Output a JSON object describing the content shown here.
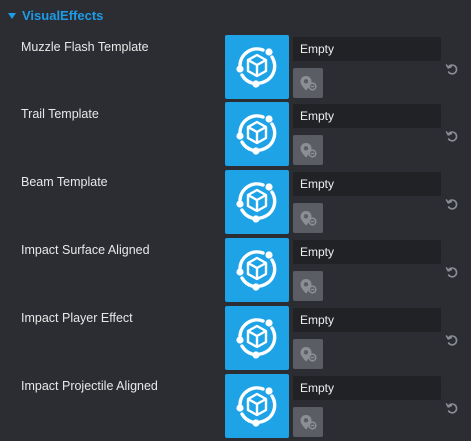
{
  "section": {
    "title": "VisualEffects",
    "expanded": true,
    "accent_color": "#1e9be6"
  },
  "asset_icon": "cube-orbit-icon",
  "picker_icon": "location-pin-icon",
  "reset_icon": "reset-icon",
  "thumbnail_color": "#1ea3e6",
  "rows": [
    {
      "label": "Muzzle Flash Template",
      "value": "Empty"
    },
    {
      "label": "Trail Template",
      "value": "Empty"
    },
    {
      "label": "Beam Template",
      "value": "Empty"
    },
    {
      "label": "Impact Surface Aligned",
      "value": "Empty"
    },
    {
      "label": "Impact Player Effect",
      "value": "Empty"
    },
    {
      "label": "Impact Projectile Aligned",
      "value": "Empty"
    }
  ]
}
